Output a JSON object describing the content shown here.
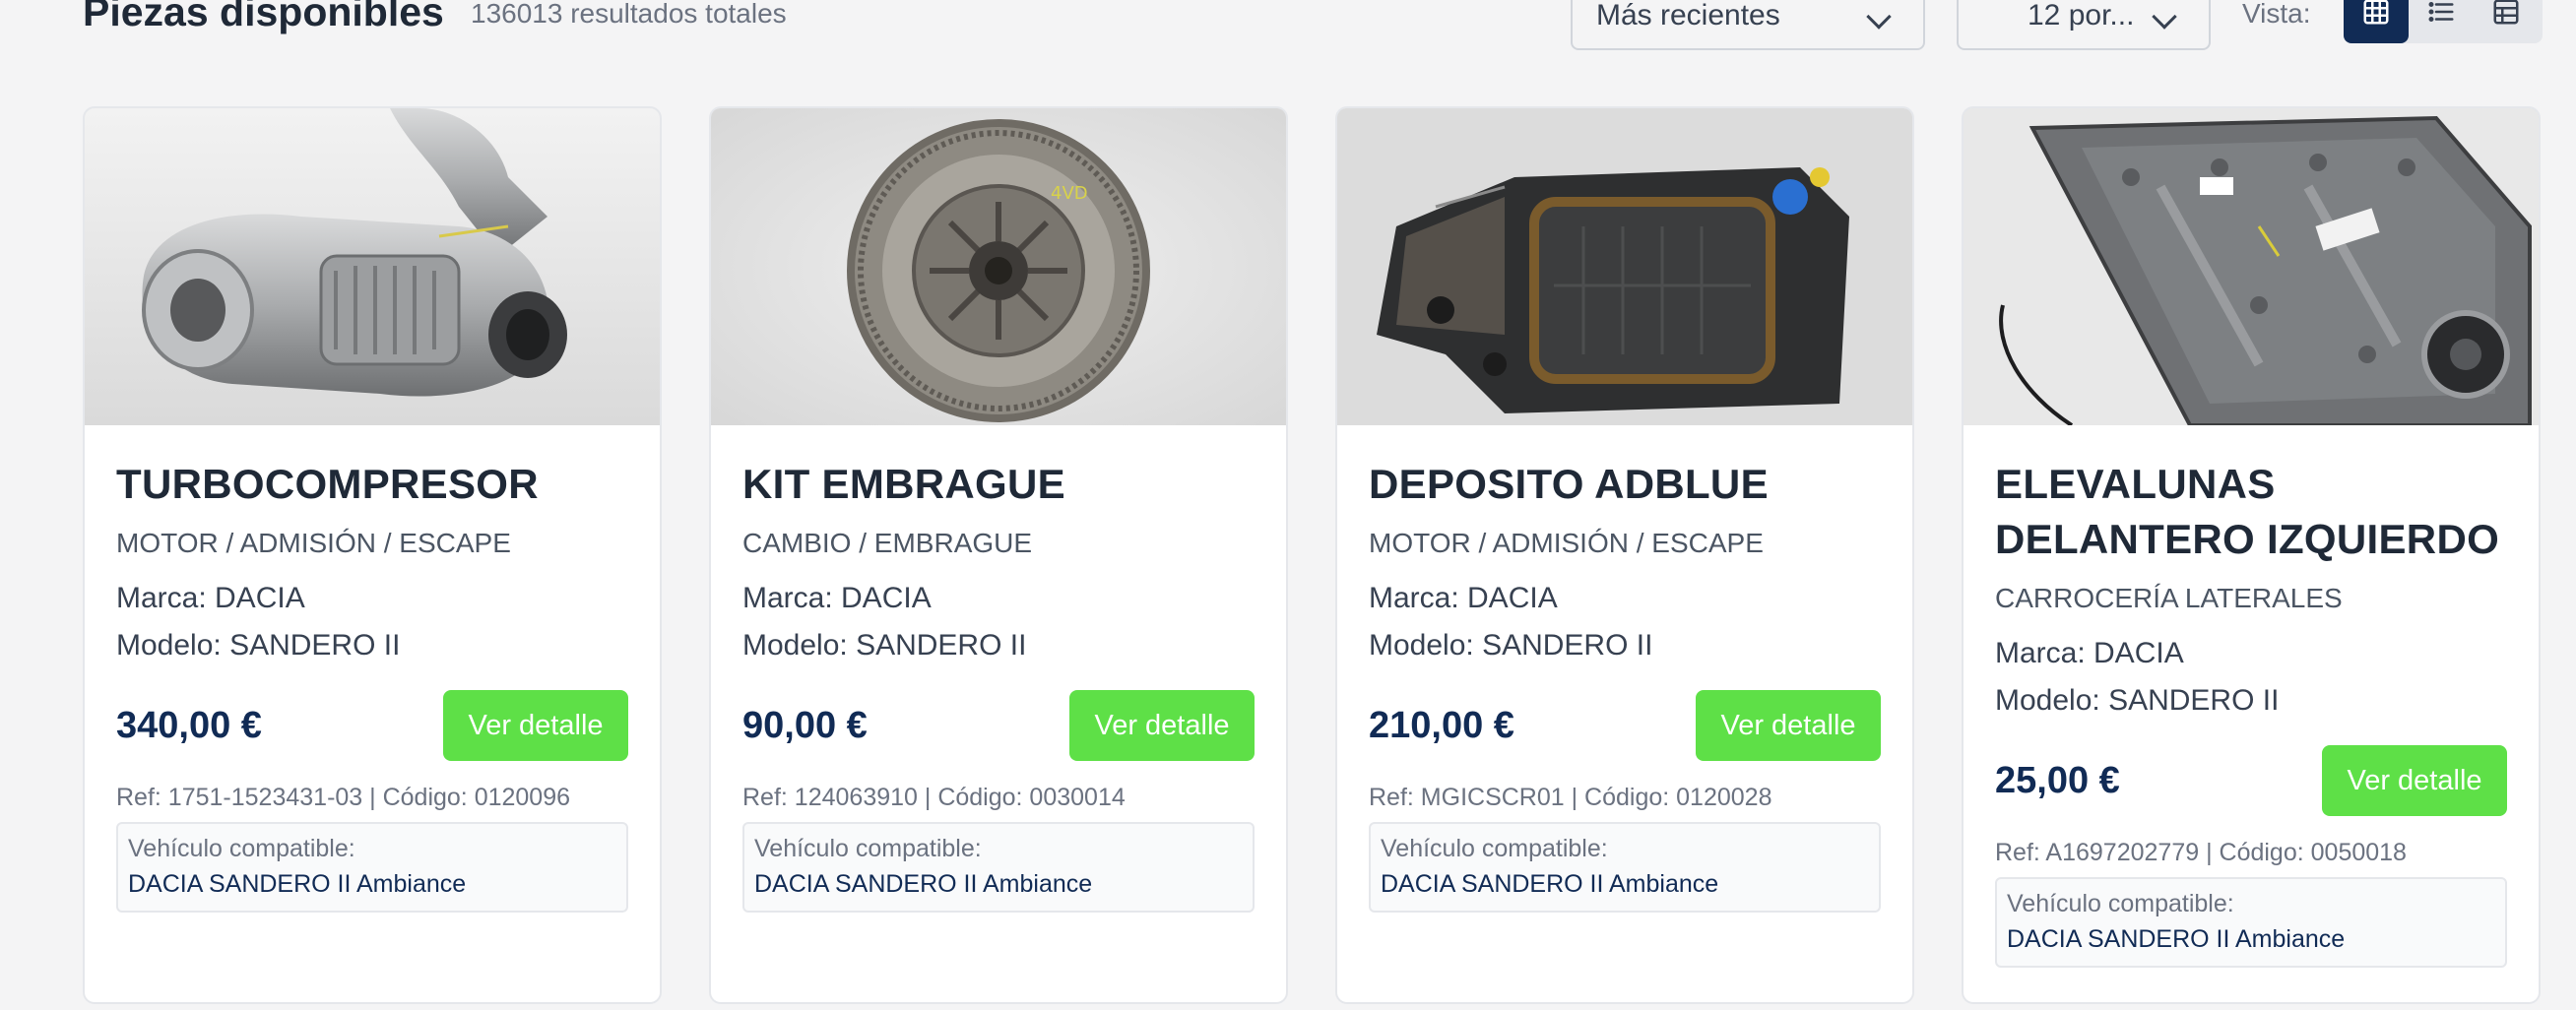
{
  "header": {
    "title": "Piezas disponibles",
    "result_count": "136013 resultados totales",
    "sort_select": "Más recientes",
    "per_page_select": "12 por...",
    "view_label": "Vista:",
    "view_modes": [
      "grid-icon",
      "list-icon",
      "table-icon"
    ],
    "active_view": "grid"
  },
  "theme": {
    "navy": "#112b55",
    "green": "#5ee047",
    "background": "#f4f4f5"
  },
  "products": [
    {
      "title": "TURBOCOMPRESOR",
      "category": "MOTOR / ADMISIÓN / ESCAPE",
      "brand": "Marca: DACIA",
      "model": "Modelo: SANDERO II",
      "price": "340,00 €",
      "button": "Ver detalle",
      "ref": "Ref: 1751-1523431-03 | Código: 0120096",
      "compat_label": "Vehículo compatible:",
      "compat_vehicle": "DACIA SANDERO II Ambiance",
      "image": "turbocharger-photo"
    },
    {
      "title": "KIT EMBRAGUE",
      "category": "CAMBIO / EMBRAGUE",
      "brand": "Marca: DACIA",
      "model": "Modelo: SANDERO II",
      "price": "90,00 €",
      "button": "Ver detalle",
      "ref": "Ref: 124063910 | Código: 0030014",
      "compat_label": "Vehículo compatible:",
      "compat_vehicle": "DACIA SANDERO II Ambiance",
      "image": "clutch-kit-photo"
    },
    {
      "title": "DEPOSITO ADBLUE",
      "category": "MOTOR / ADMISIÓN / ESCAPE",
      "brand": "Marca: DACIA",
      "model": "Modelo: SANDERO II",
      "price": "210,00 €",
      "button": "Ver detalle",
      "ref": "Ref: MGICSCR01 | Código: 0120028",
      "compat_label": "Vehículo compatible:",
      "compat_vehicle": "DACIA SANDERO II Ambiance",
      "image": "adblue-tank-photo"
    },
    {
      "title": "ELEVALUNAS DELANTERO IZQUIERDO",
      "category": "CARROCERÍA LATERALES",
      "brand": "Marca: DACIA",
      "model": "Modelo: SANDERO II",
      "price": "25,00 €",
      "button": "Ver detalle",
      "ref": "Ref: A1697202779 | Código: 0050018",
      "compat_label": "Vehículo compatible:",
      "compat_vehicle": "DACIA SANDERO II Ambiance",
      "image": "window-regulator-photo"
    }
  ]
}
